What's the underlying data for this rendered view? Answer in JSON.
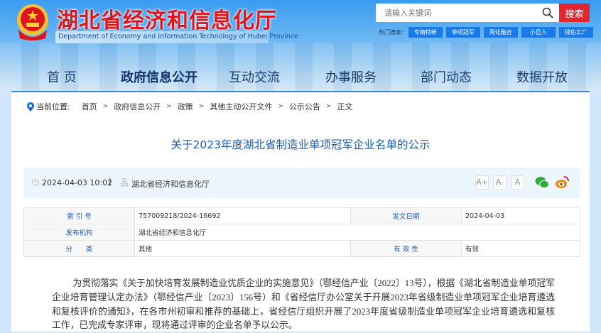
{
  "header": {
    "title": "湖北省经济和信息化厅",
    "subtitle": "Department of Economy and Information Technology of Hubei Province",
    "search_placeholder": "请输入关键词",
    "search_button": "搜索",
    "hot_label": "热门搜索:",
    "hot_tags": [
      "专精特新",
      "单项冠军",
      "两化融合",
      "小巨人",
      "绿色工厂"
    ]
  },
  "nav": [
    "首 页",
    "政府信息公开",
    "互动交流",
    "办事服务",
    "部门动态",
    "数据开放"
  ],
  "breadcrumb": {
    "label": "当前位置:",
    "items": [
      "首页",
      "政府信息公开",
      "政策",
      "其他主动公开文件",
      "公示公告",
      "正文"
    ],
    "separator": ">"
  },
  "article": {
    "title": "关于2023年度湖北省制造业单项冠军企业名单的公示",
    "date": "2024-04-03 10:02",
    "source": "湖北省经济和信息化厅",
    "font_sizes": [
      "A+",
      "A-",
      "A"
    ],
    "info": {
      "index_label": "索 引 号",
      "index": "757009218/2024-16692",
      "date_label": "发文日期",
      "date": "2024-04-03",
      "publisher_label": "发布机构",
      "publisher": "湖北省经济和信息化厅",
      "category_label": "分　　类",
      "category": "其他",
      "validity_label": "有 效 性",
      "validity": "有效"
    },
    "body": "为贯彻落实《关于加快培育发展制造业优质企业的实施意见》（鄂经信产业〔2022〕13号），根据《湖北省制造业单项冠军企业培育管理认定办法》（鄂经信产业〔2023〕156号）和《省经信厅办公室关于开展2023年省级制造业单项冠军企业培育遴选和复核评价的通知》，在各市州初审和推荐的基础上，省经信厅组织开展了2023年度省级制造业单项冠军企业培育遴选和复核工作，已完成专家评审，现将通过评审的企业名单予以公示。"
  },
  "colors": {
    "accent": "#1b5cb4",
    "search": "#e3262b",
    "tag": "#1a7be8"
  }
}
